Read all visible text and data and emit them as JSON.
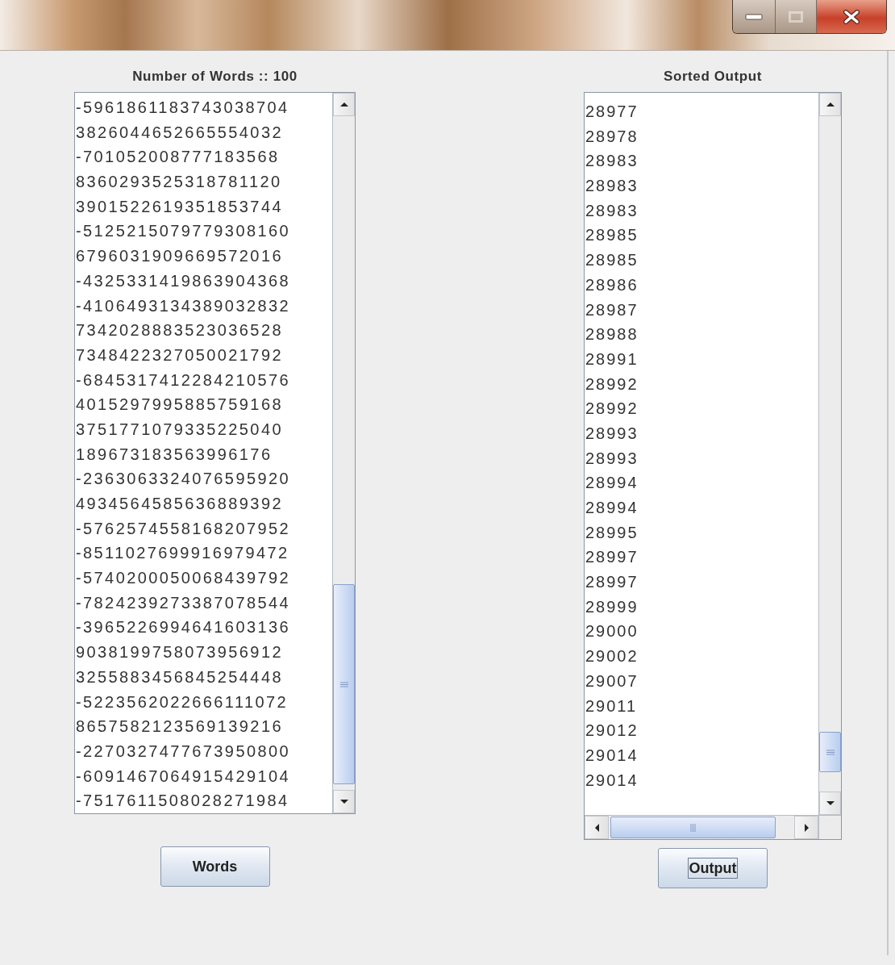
{
  "window": {
    "controls": [
      {
        "kind": "minimize",
        "disabled": false
      },
      {
        "kind": "maximize",
        "disabled": true
      },
      {
        "kind": "close",
        "disabled": false
      }
    ]
  },
  "panels": [
    {
      "heading": "Number of Words :: 100",
      "horizontal_scrollbar": false,
      "items": [
        "-5961861183743038704",
        "3826044652665554032",
        "-701052008777183568",
        "8360293525318781120",
        "3901522619351853744",
        "-5125215079779308160",
        "6796031909669572016",
        "-4325331419863904368",
        "-4106493134389032832",
        "7342028883523036528",
        "7348422327050021792",
        "-6845317412284210576",
        "4015297995885759168",
        "3751771079335225040",
        "189673183563996176",
        "-2363063324076595920",
        "4934564585636889392",
        "-5762574558168207952",
        "-8511027699916979472",
        "-5740200050068439792",
        "-7824239273387078544",
        "-3965226994641603136",
        "9038199758073956912",
        "3255883456845254448",
        "-5223562022666111072",
        "8657582123569139216",
        "-2270327477673950800",
        "-6091467064915429104",
        "-7517611508028271984"
      ],
      "button": {
        "label": "Words",
        "focused": false
      }
    },
    {
      "heading": "Sorted Output",
      "horizontal_scrollbar": true,
      "items": [
        "28977",
        "28978",
        "28983",
        "28983",
        "28983",
        "28985",
        "28985",
        "28986",
        "28987",
        "28988",
        "28991",
        "28992",
        "28992",
        "28993",
        "28993",
        "28994",
        "28994",
        "28995",
        "28997",
        "28997",
        "28999",
        "29000",
        "29002",
        "29007",
        "29011",
        "29012",
        "29014",
        "29014"
      ],
      "button": {
        "label": "Output",
        "focused": true
      }
    }
  ]
}
